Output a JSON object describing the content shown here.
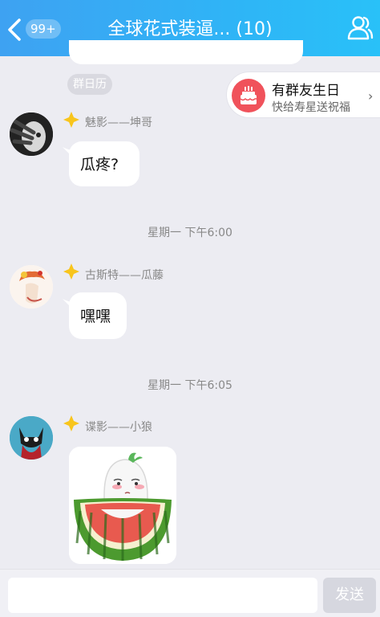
{
  "header": {
    "badge": "99+",
    "title": "全球花式装逼... (10)"
  },
  "colors": {
    "header_start": "#3ea2f2",
    "header_end": "#29c1f8",
    "background": "#ececf2",
    "birthday_icon": "#f0525b"
  },
  "calendar_chip": "群日历",
  "birthday_banner": {
    "title": "有群友生日",
    "subtitle": "快给寿星送祝福",
    "arrow": "›"
  },
  "messages": [
    {
      "sender": "魅影——坤哥",
      "text": "瓜疼?"
    },
    {
      "time": "星期一 下午6:00"
    },
    {
      "sender": "古斯特——瓜藤",
      "text": "嘿嘿"
    },
    {
      "time": "星期一 下午6:05"
    },
    {
      "sender": "谍影——小狼",
      "sticker": "watermelon-ghost-sticker"
    }
  ],
  "input": {
    "placeholder": "",
    "send_label": "发送"
  }
}
